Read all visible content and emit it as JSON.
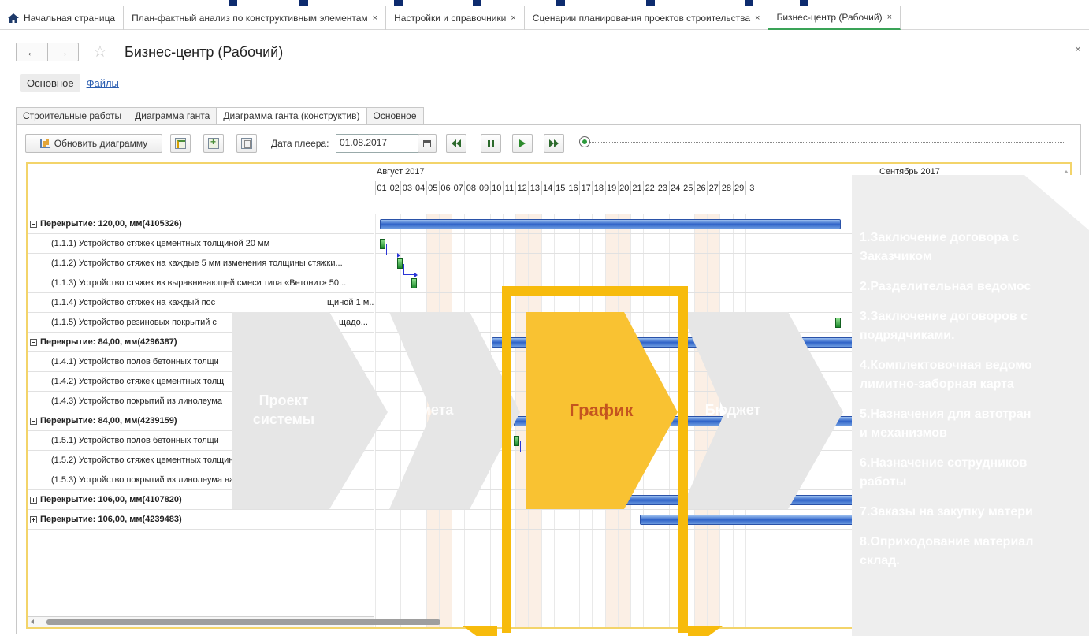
{
  "top_tabs": [
    {
      "label": "Начальная страница",
      "home": true,
      "closable": false
    },
    {
      "label": "План-фактный анализ по конструктивным элементам",
      "closable": true
    },
    {
      "label": "Настройки и справочники",
      "closable": true
    },
    {
      "label": "Сценарии планирования проектов строительства",
      "closable": true
    },
    {
      "label": "Бизнес-центр (Рабочий)",
      "closable": true,
      "active": true
    }
  ],
  "close_glyph": "×",
  "nav": {
    "back": "←",
    "forward": "→",
    "star": "☆",
    "close": "×"
  },
  "document_title": "Бизнес-центр (Рабочий)",
  "sub_tabs": {
    "main": "Основное",
    "files": "Файлы"
  },
  "inner_tabs": [
    "Строительные работы",
    "Диаграмма ганта",
    "Диаграмма ганта (конструктив)",
    "Основное"
  ],
  "toolbar": {
    "refresh_label": "Обновить диаграмму",
    "player_date_label": "Дата плеера:",
    "player_date_value": "01.08.2017",
    "calendar_icon": "calendar-icon"
  },
  "gantt": {
    "months": [
      "Август 2017",
      "Сентябрь 2017"
    ],
    "days": [
      "01",
      "02",
      "03",
      "04",
      "05",
      "06",
      "07",
      "08",
      "09",
      "10",
      "11",
      "12",
      "13",
      "14",
      "15",
      "16",
      "17",
      "18",
      "19",
      "20",
      "21",
      "22",
      "23",
      "24",
      "25",
      "26",
      "27",
      "28",
      "29",
      "3"
    ],
    "rows": [
      {
        "type": "group",
        "label": "Перекрытие: 120,00, мм(4105326)",
        "expanded": true
      },
      {
        "type": "task",
        "label": "(1.1.1) Устройство стяжек цементных толщиной 20 мм"
      },
      {
        "type": "task",
        "label": "(1.1.2) Устройство стяжек на каждые 5 мм изменения толщины стяжки..."
      },
      {
        "type": "task",
        "label": "(1.1.3) Устройство стяжек из выравнивающей смеси типа «Ветонит» 50..."
      },
      {
        "type": "task",
        "label": "(1.1.4) Устройство стяжек на каждый пос",
        "label_tail": "щиной 1 м..."
      },
      {
        "type": "task",
        "label": "(1.1.5) Устройство резиновых покрытий с",
        "label_tail": "щадо..."
      },
      {
        "type": "group",
        "label": "Перекрытие: 84,00, мм(4296387)",
        "expanded": true
      },
      {
        "type": "task",
        "label": "(1.4.1) Устройство полов бетонных толщи"
      },
      {
        "type": "task",
        "label": "(1.4.2) Устройство стяжек цементных толщ"
      },
      {
        "type": "task",
        "label": "(1.4.3) Устройство покрытий из линолеума"
      },
      {
        "type": "group",
        "label": "Перекрытие: 84,00, мм(4239159)",
        "expanded": true
      },
      {
        "type": "task",
        "label": "(1.5.1) Устройство полов бетонных толщи"
      },
      {
        "type": "task",
        "label": "(1.5.2) Устройство стяжек цементных толщиной 20 мм"
      },
      {
        "type": "task",
        "label": "(1.5.3) Устройство покрытий из линолеума на клее «Бустилат»"
      },
      {
        "type": "group",
        "label": "Перекрытие: 106,00, мм(4107820)",
        "expanded": false
      },
      {
        "type": "group",
        "label": "Перекрытие: 106,00, мм(4239483)",
        "expanded": false
      }
    ]
  },
  "process_chevrons": [
    {
      "label": "Проект системы",
      "line1": "Проект",
      "line2": "системы"
    },
    {
      "label": "Смета"
    },
    {
      "label": "График",
      "highlighted": true
    },
    {
      "label": "Бюджет"
    }
  ],
  "process_steps": [
    {
      "line1": "1.Заключение договора с",
      "line2": "Заказчиком"
    },
    {
      "line1": "2.Разделительная ведомос",
      "line2": ""
    },
    {
      "line1": "3.Заключение договоров с",
      "line2": "подрядчиками."
    },
    {
      "line1": "4.Комплектовочная ведомо",
      "line2": "лимитно-заборная  карта"
    },
    {
      "line1": "5.Назначения для автотран",
      "line2": "и механизмов"
    },
    {
      "line1": "6.Назначение сотрудников",
      "line2": "работы"
    },
    {
      "line1": "7.Заказы на закупку матери",
      "line2": ""
    },
    {
      "line1": "8.Оприходование материал",
      "line2": "склад."
    }
  ],
  "colors": {
    "highlight": "#f7bb0c",
    "highlight_text": "#c4541f",
    "bar_blue": "#2f63c8",
    "bar_green": "#1c8a2c",
    "active_tab": "#3aa357",
    "title_bar_blue": "#0d2b6e"
  }
}
